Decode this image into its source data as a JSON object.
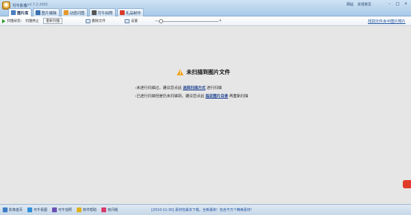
{
  "app": {
    "name": "可牛影像",
    "version": "v2.7.2.2001"
  },
  "top_links": [
    "网站",
    "反馈意见"
  ],
  "window_buttons": [
    "–",
    "□",
    "×"
  ],
  "tabs": [
    {
      "label": "图片库",
      "icon": "gallery-icon",
      "color": "#4b7fbf",
      "active": true
    },
    {
      "label": "图片编辑",
      "icon": "edit-icon",
      "color": "#3a6fb0",
      "active": false
    },
    {
      "label": "动感闪图",
      "icon": "flash-icon",
      "color": "#e39a2a",
      "active": false
    },
    {
      "label": "可牛拍照",
      "icon": "camera-icon",
      "color": "#555555",
      "active": false
    },
    {
      "label": "礼品制作",
      "icon": "gift-icon",
      "color": "#d93a2b",
      "active": false
    }
  ],
  "toolbar": {
    "scan_status": "扫描状态：",
    "scan_stop": "扫描停止",
    "rescan": "重新扫描",
    "delete_file": "删除文件",
    "settings": "设置",
    "zoom_minus": "−",
    "zoom_plus": "+",
    "find_link": "找回文件夹中图片照片"
  },
  "message": {
    "title": "未扫描到图片文件",
    "line1_prefix": "›未进行扫描过，建议您点此",
    "line1_link": "选择扫描方式",
    "line1_suffix": "进行扫描",
    "line2_prefix": "›已进行扫描但是仍未扫描到，建议您点此",
    "line2_link": "指定图片目录",
    "line2_suffix": "再重新扫描"
  },
  "statusbar": {
    "items": [
      {
        "label": "影像首页",
        "icon": "home-icon",
        "color": "#3d7cc4"
      },
      {
        "label": "可牛看图",
        "icon": "viewer-icon",
        "color": "#2f8fd8"
      },
      {
        "label": "可牛拍照",
        "icon": "camera-icon",
        "color": "#6b4fb5"
      },
      {
        "label": "软件帮助",
        "icon": "help-icon",
        "color": "#e0b020"
      },
      {
        "label": "有问题",
        "icon": "question-icon",
        "color": "#d93a6a"
      }
    ],
    "news": "[2010-11-30] 素材包版本下载，全新版体！包含不万个精美素材！"
  },
  "colors": {
    "accent": "#1b4f9e",
    "warning": "#f0a418"
  }
}
